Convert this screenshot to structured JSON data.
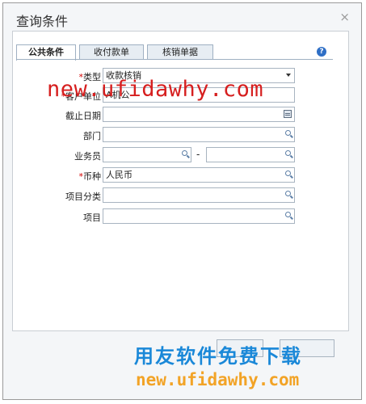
{
  "window": {
    "title": "查询条件",
    "close_glyph": "×"
  },
  "tabs": [
    {
      "label": "公共条件",
      "active": true
    },
    {
      "label": "收付款单",
      "active": false
    },
    {
      "label": "核销单据",
      "active": false
    }
  ],
  "help_icon": "?",
  "form": {
    "type": {
      "label": "类型",
      "required_mark": "*",
      "value": "收款核销"
    },
    "unit": {
      "label": "客户单位",
      "required_mark": "*",
      "value": "A机公"
    },
    "cutoff_date": {
      "label": "截止日期",
      "value": ""
    },
    "department": {
      "label": "部门",
      "value": ""
    },
    "salesperson": {
      "label": "业务员",
      "value_from": "",
      "separator": "-",
      "value_to": ""
    },
    "currency": {
      "label": "币种",
      "required_mark": "*",
      "value": "人民币"
    },
    "project_category": {
      "label": "项目分类",
      "value": ""
    },
    "project": {
      "label": "项目",
      "value": ""
    }
  },
  "watermark": {
    "top_url": "new.ufidawhy.com",
    "slogan": "用友软件免费下载",
    "bottom_url": "new.ufidawhy.com"
  },
  "colors": {
    "watermark_red": "#d61f1f",
    "watermark_blue": "#1a88d8",
    "watermark_orange": "#f2a326",
    "required_red": "#d40000"
  }
}
